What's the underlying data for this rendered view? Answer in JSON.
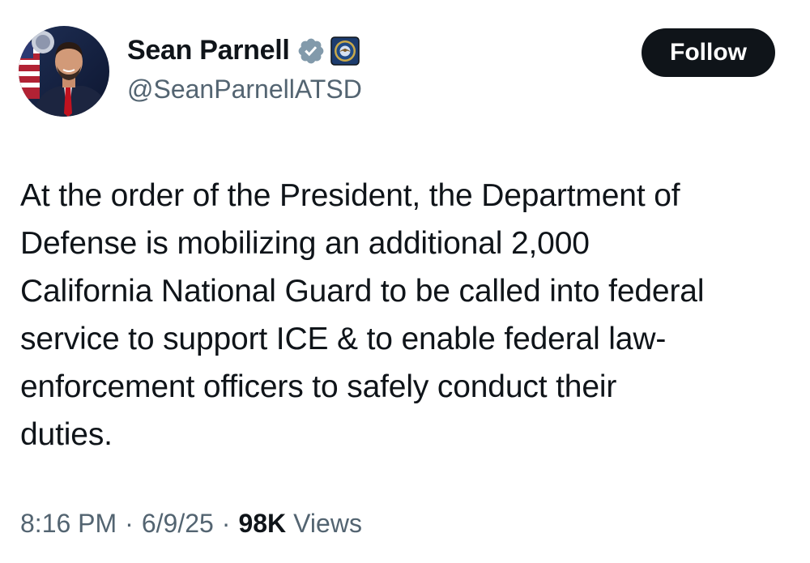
{
  "author": {
    "display_name": "Sean Parnell",
    "handle": "@SeanParnellATSD",
    "avatar_icon": "profile-photo",
    "verified_badge_icon": "verified-checkmark-badge",
    "affiliate_badge_icon": "department-of-defense-seal"
  },
  "follow_label": "Follow",
  "tweet": {
    "text": "At the order of the President, the Department of\nDefense is mobilizing an additional 2,000\nCalifornia National Guard to be called into federal\nservice to support ICE & to enable federal law-\nenforcement officers to safely conduct their\nduties."
  },
  "meta": {
    "time": "8:16 PM",
    "separator": "·",
    "date": "6/9/25",
    "views_count": "98K",
    "views_label": "Views"
  },
  "colors": {
    "text_primary": "#0f1419",
    "text_secondary": "#536471",
    "verified_badge": "#829aab",
    "follow_button_bg": "#0f1419",
    "follow_button_text": "#ffffff"
  }
}
